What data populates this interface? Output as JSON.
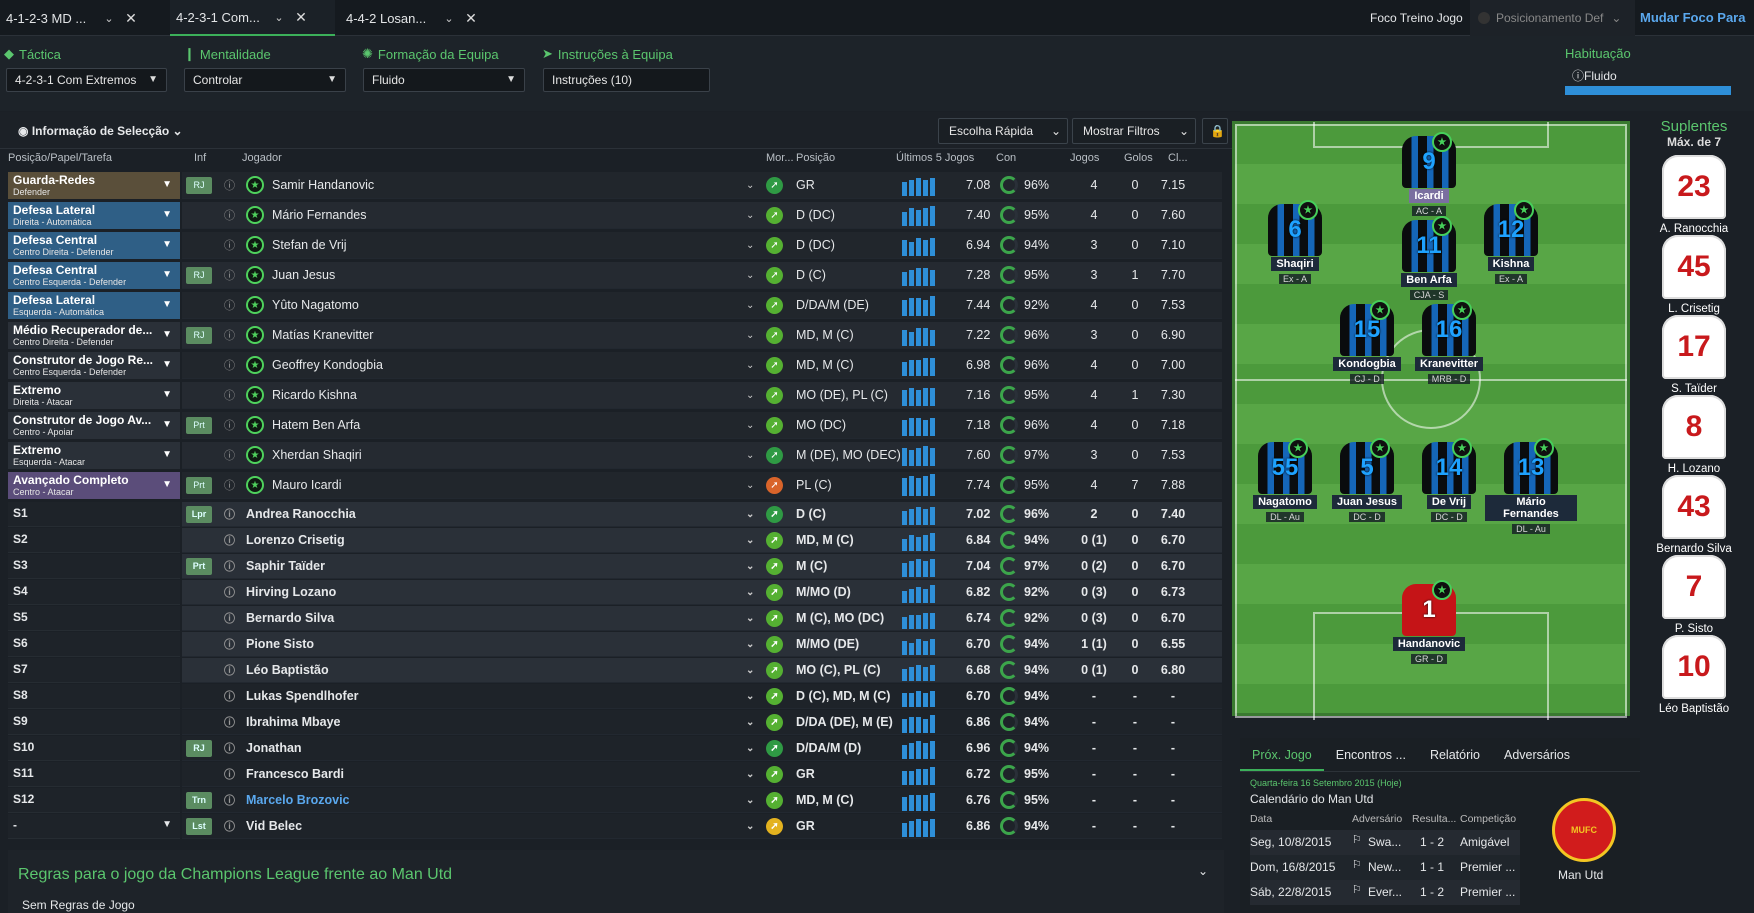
{
  "tabs": [
    {
      "label": "4-1-2-3 MD ..."
    },
    {
      "label": "4-2-3-1 Com..."
    },
    {
      "label": "4-4-2 Losan..."
    }
  ],
  "topright": {
    "foco_label": "Foco Treino Jogo",
    "foco_value": "Posicionamento Def",
    "mudar": "Mudar Foco Para"
  },
  "tactic": {
    "tactica": "Táctica",
    "tactica_value": "4-2-3-1 Com Extremos",
    "mentalidade": "Mentalidade",
    "mentalidade_value": "Controlar",
    "formacao": "Formação da Equipa",
    "formacao_value": "Fluido",
    "instrucoes": "Instruções à Equipa",
    "instrucoes_value": "Instruções (10)",
    "habituacao": "Habituação",
    "habituacao_value": "Fluido"
  },
  "selection": {
    "info": "Informação de Selecção",
    "escolha": "Escolha Rápida",
    "filtros": "Mostrar Filtros"
  },
  "cols": {
    "pos": "Posição/Papel/Tarefa",
    "inf": "Inf",
    "jogador": "Jogador",
    "mor": "Mor...",
    "posicao": "Posição",
    "ult": "Últimos 5 Jogos",
    "con": "Con",
    "jogos": "Jogos",
    "golos": "Golos",
    "cl": "Cl..."
  },
  "roles": [
    {
      "title": "Guarda-Redes",
      "sub": "Defender",
      "color": "#5a4f3a"
    },
    {
      "title": "Defesa Lateral",
      "sub": "Direita - Automática",
      "color": "#2f5f86"
    },
    {
      "title": "Defesa Central",
      "sub": "Centro Direita - Defender",
      "color": "#2f5f86"
    },
    {
      "title": "Defesa Central",
      "sub": "Centro Esquerda - Defender",
      "color": "#2f5f86"
    },
    {
      "title": "Defesa Lateral",
      "sub": "Esquerda - Automática",
      "color": "#2f5f86"
    },
    {
      "title": "Médio Recuperador de...",
      "sub": "Centro Direita - Defender",
      "color": "#2a3038"
    },
    {
      "title": "Construtor de Jogo Re...",
      "sub": "Centro Esquerda - Defender",
      "color": "#2a3038"
    },
    {
      "title": "Extremo",
      "sub": "Direita - Atacar",
      "color": "#2a3038"
    },
    {
      "title": "Construtor de Jogo Av...",
      "sub": "Centro - Apoiar",
      "color": "#2a3038"
    },
    {
      "title": "Extremo",
      "sub": "Esquerda - Atacar",
      "color": "#2a3038"
    },
    {
      "title": "Avançado Completo",
      "sub": "Centro - Atacar",
      "color": "#5b4d7a"
    }
  ],
  "sublabels": [
    "S1",
    "S2",
    "S3",
    "S4",
    "S5",
    "S6",
    "S7",
    "S8",
    "S9",
    "S10",
    "S11",
    "S12",
    "-"
  ],
  "players": [
    {
      "inf": "RJ",
      "name": "Samir Handanovic",
      "pos": "GR",
      "avg": "7.08",
      "con": "96%",
      "jogos": "4",
      "golos": "0",
      "cl": "7.15",
      "m": "#2f9a44",
      "star": true
    },
    {
      "inf": "",
      "name": "Mário Fernandes",
      "pos": "D (DC)",
      "avg": "7.40",
      "con": "95%",
      "jogos": "4",
      "golos": "0",
      "cl": "7.60",
      "m": "#55b032",
      "star": true
    },
    {
      "inf": "",
      "name": "Stefan de Vrij",
      "pos": "D (DC)",
      "avg": "6.94",
      "con": "94%",
      "jogos": "3",
      "golos": "0",
      "cl": "7.10",
      "m": "#55b032",
      "star": true
    },
    {
      "inf": "RJ",
      "name": "Juan Jesus",
      "pos": "D (C)",
      "avg": "7.28",
      "con": "95%",
      "jogos": "3",
      "golos": "1",
      "cl": "7.70",
      "m": "#55b032",
      "star": true
    },
    {
      "inf": "",
      "name": "Yûto Nagatomo",
      "pos": "D/DA/M (DE)",
      "avg": "7.44",
      "con": "92%",
      "jogos": "4",
      "golos": "0",
      "cl": "7.53",
      "m": "#55b032",
      "star": true
    },
    {
      "inf": "RJ",
      "name": "Matías Kranevitter",
      "pos": "MD, M (C)",
      "avg": "7.22",
      "con": "96%",
      "jogos": "3",
      "golos": "0",
      "cl": "6.90",
      "m": "#55b032",
      "star": true
    },
    {
      "inf": "",
      "name": "Geoffrey Kondogbia",
      "pos": "MD, M (C)",
      "avg": "6.98",
      "con": "96%",
      "jogos": "4",
      "golos": "0",
      "cl": "7.00",
      "m": "#55b032",
      "star": true
    },
    {
      "inf": "",
      "name": "Ricardo Kishna",
      "pos": "MO (DE), PL (C)",
      "avg": "7.16",
      "con": "95%",
      "jogos": "4",
      "golos": "1",
      "cl": "7.30",
      "m": "#55b032",
      "star": true
    },
    {
      "inf": "Prt",
      "name": "Hatem Ben Arfa",
      "pos": "MO (DC)",
      "avg": "7.18",
      "con": "96%",
      "jogos": "4",
      "golos": "0",
      "cl": "7.18",
      "m": "#55b032",
      "star": true
    },
    {
      "inf": "",
      "name": "Xherdan Shaqiri",
      "pos": "M (DE), MO (DEC)",
      "avg": "7.60",
      "con": "97%",
      "jogos": "3",
      "golos": "0",
      "cl": "7.53",
      "m": "#2f9a44",
      "star": true
    },
    {
      "inf": "Prt",
      "name": "Mauro Icardi",
      "pos": "PL (C)",
      "avg": "7.74",
      "con": "95%",
      "jogos": "4",
      "golos": "7",
      "cl": "7.88",
      "m": "#d9642a",
      "star": true
    },
    {
      "inf": "Lpr",
      "name": "Andrea Ranocchia",
      "pos": "D (C)",
      "avg": "7.02",
      "con": "96%",
      "jogos": "2",
      "golos": "0",
      "cl": "7.40",
      "m": "#2f9a44",
      "star": false
    },
    {
      "inf": "",
      "name": "Lorenzo Crisetig",
      "pos": "MD, M (C)",
      "avg": "6.84",
      "con": "94%",
      "jogos": "0 (1)",
      "golos": "0",
      "cl": "6.70",
      "m": "#55b032",
      "star": false
    },
    {
      "inf": "Prt",
      "name": "Saphir Taïder",
      "pos": "M (C)",
      "avg": "7.04",
      "con": "97%",
      "jogos": "0 (2)",
      "golos": "0",
      "cl": "6.70",
      "m": "#55b032",
      "star": false
    },
    {
      "inf": "",
      "name": "Hirving Lozano",
      "pos": "M/MO (D)",
      "avg": "6.82",
      "con": "92%",
      "jogos": "0 (3)",
      "golos": "0",
      "cl": "6.73",
      "m": "#55b032",
      "star": false
    },
    {
      "inf": "",
      "name": "Bernardo Silva",
      "pos": "M (C), MO (DC)",
      "avg": "6.74",
      "con": "92%",
      "jogos": "0 (3)",
      "golos": "0",
      "cl": "6.70",
      "m": "#55b032",
      "star": false
    },
    {
      "inf": "",
      "name": "Pione Sisto",
      "pos": "M/MO (DE)",
      "avg": "6.70",
      "con": "94%",
      "jogos": "1 (1)",
      "golos": "0",
      "cl": "6.55",
      "m": "#55b032",
      "star": false
    },
    {
      "inf": "",
      "name": "Léo Baptistão",
      "pos": "MO (C), PL (C)",
      "avg": "6.68",
      "con": "94%",
      "jogos": "0 (1)",
      "golos": "0",
      "cl": "6.80",
      "m": "#55b032",
      "star": false
    },
    {
      "inf": "",
      "name": "Lukas Spendlhofer",
      "pos": "D (C), MD, M (C)",
      "avg": "6.70",
      "con": "94%",
      "jogos": "-",
      "golos": "-",
      "cl": "-",
      "m": "#55b032",
      "star": false
    },
    {
      "inf": "",
      "name": "Ibrahima Mbaye",
      "pos": "D/DA (DE), M (E)",
      "avg": "6.86",
      "con": "94%",
      "jogos": "-",
      "golos": "-",
      "cl": "-",
      "m": "#55b032",
      "star": false
    },
    {
      "inf": "RJ",
      "name": "Jonathan",
      "pos": "D/DA/M (D)",
      "avg": "6.96",
      "con": "94%",
      "jogos": "-",
      "golos": "-",
      "cl": "-",
      "m": "#2f9a44",
      "star": false
    },
    {
      "inf": "",
      "name": "Francesco Bardi",
      "pos": "GR",
      "avg": "6.72",
      "con": "95%",
      "jogos": "-",
      "golos": "-",
      "cl": "-",
      "m": "#55b032",
      "star": false
    },
    {
      "inf": "Trn",
      "name": "Marcelo Brozovic",
      "pos": "MD, M (C)",
      "avg": "6.76",
      "con": "95%",
      "jogos": "-",
      "golos": "-",
      "cl": "-",
      "m": "#55b032",
      "star": false,
      "link": true
    },
    {
      "inf": "Lst",
      "name": "Vid Belec",
      "pos": "GR",
      "avg": "6.86",
      "con": "94%",
      "jogos": "-",
      "golos": "-",
      "cl": "-",
      "m": "#e3b21f",
      "star": false
    }
  ],
  "pitch": [
    {
      "num": "9",
      "name": "Icardi",
      "role": "AC - A",
      "cls": ""
    },
    {
      "num": "6",
      "name": "Shaqiri",
      "role": "Ex - A",
      "cls": ""
    },
    {
      "num": "11",
      "name": "Ben Arfa",
      "role": "CJA - S",
      "cls": ""
    },
    {
      "num": "12",
      "name": "Kishna",
      "role": "Ex - A",
      "cls": ""
    },
    {
      "num": "15",
      "name": "Kondogbia",
      "role": "CJ - D",
      "cls": ""
    },
    {
      "num": "16",
      "name": "Kranevitter",
      "role": "MRB - D",
      "cls": ""
    },
    {
      "num": "55",
      "name": "Nagatomo",
      "role": "DL - Au",
      "cls": ""
    },
    {
      "num": "5",
      "name": "Juan Jesus",
      "role": "DC - D",
      "cls": ""
    },
    {
      "num": "14",
      "name": "De Vrij",
      "role": "DC - D",
      "cls": ""
    },
    {
      "num": "13",
      "name": "Mário Fernandes",
      "role": "DL - Au",
      "cls": ""
    },
    {
      "num": "1",
      "name": "Handanovic",
      "role": "GR - D",
      "cls": "red"
    }
  ],
  "subs": {
    "title": "Suplentes",
    "max": "Máx. de 7",
    "list": [
      {
        "num": "23",
        "name": "A. Ranocchia"
      },
      {
        "num": "45",
        "name": "L. Crisetig"
      },
      {
        "num": "17",
        "name": "S. Taïder"
      },
      {
        "num": "8",
        "name": "H. Lozano"
      },
      {
        "num": "43",
        "name": "Bernardo Silva"
      },
      {
        "num": "7",
        "name": "P. Sisto"
      },
      {
        "num": "10",
        "name": "Léo Baptistão"
      }
    ]
  },
  "next": {
    "tabs": [
      "Próx. Jogo",
      "Encontros ...",
      "Relatório",
      "Adversários"
    ],
    "date": "Quarta-feira 16 Setembro 2015 (Hoje)",
    "cal": "Calendário do Man Utd",
    "cols": [
      "Data",
      "Adversário",
      "Resulta...",
      "Competição"
    ],
    "rows": [
      {
        "d": "Seg, 10/8/2015",
        "a": "Swa...",
        "r": "1 - 2",
        "c": "Amigável"
      },
      {
        "d": "Dom, 16/8/2015",
        "a": "New...",
        "r": "1 - 1",
        "c": "Premier ..."
      },
      {
        "d": "Sáb, 22/8/2015",
        "a": "Ever...",
        "r": "1 - 2",
        "c": "Premier ..."
      }
    ],
    "club": "Man Utd"
  },
  "rules": {
    "title": "Regras para o jogo da Champions League frente ao Man Utd",
    "sub": "Sem Regras de Jogo"
  }
}
